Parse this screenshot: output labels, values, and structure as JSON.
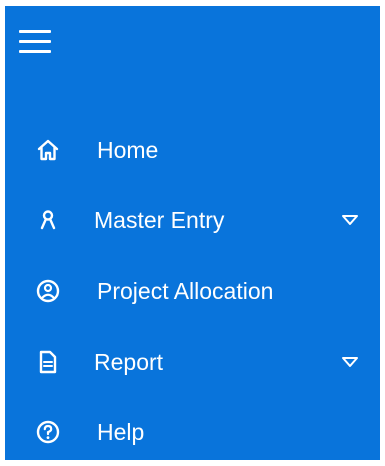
{
  "menu": {
    "toggle_icon": "hamburger-icon",
    "items": [
      {
        "label": "Home",
        "icon": "home-icon",
        "has_submenu": false
      },
      {
        "label": "Master Entry",
        "icon": "user-icon",
        "has_submenu": true
      },
      {
        "label": "Project Allocation",
        "icon": "user-circle-icon",
        "has_submenu": false
      },
      {
        "label": "Report",
        "icon": "document-icon",
        "has_submenu": true
      },
      {
        "label": "Help",
        "icon": "help-icon",
        "has_submenu": false
      }
    ]
  },
  "colors": {
    "sidebar_background": "#0974db",
    "foreground": "#ffffff"
  }
}
